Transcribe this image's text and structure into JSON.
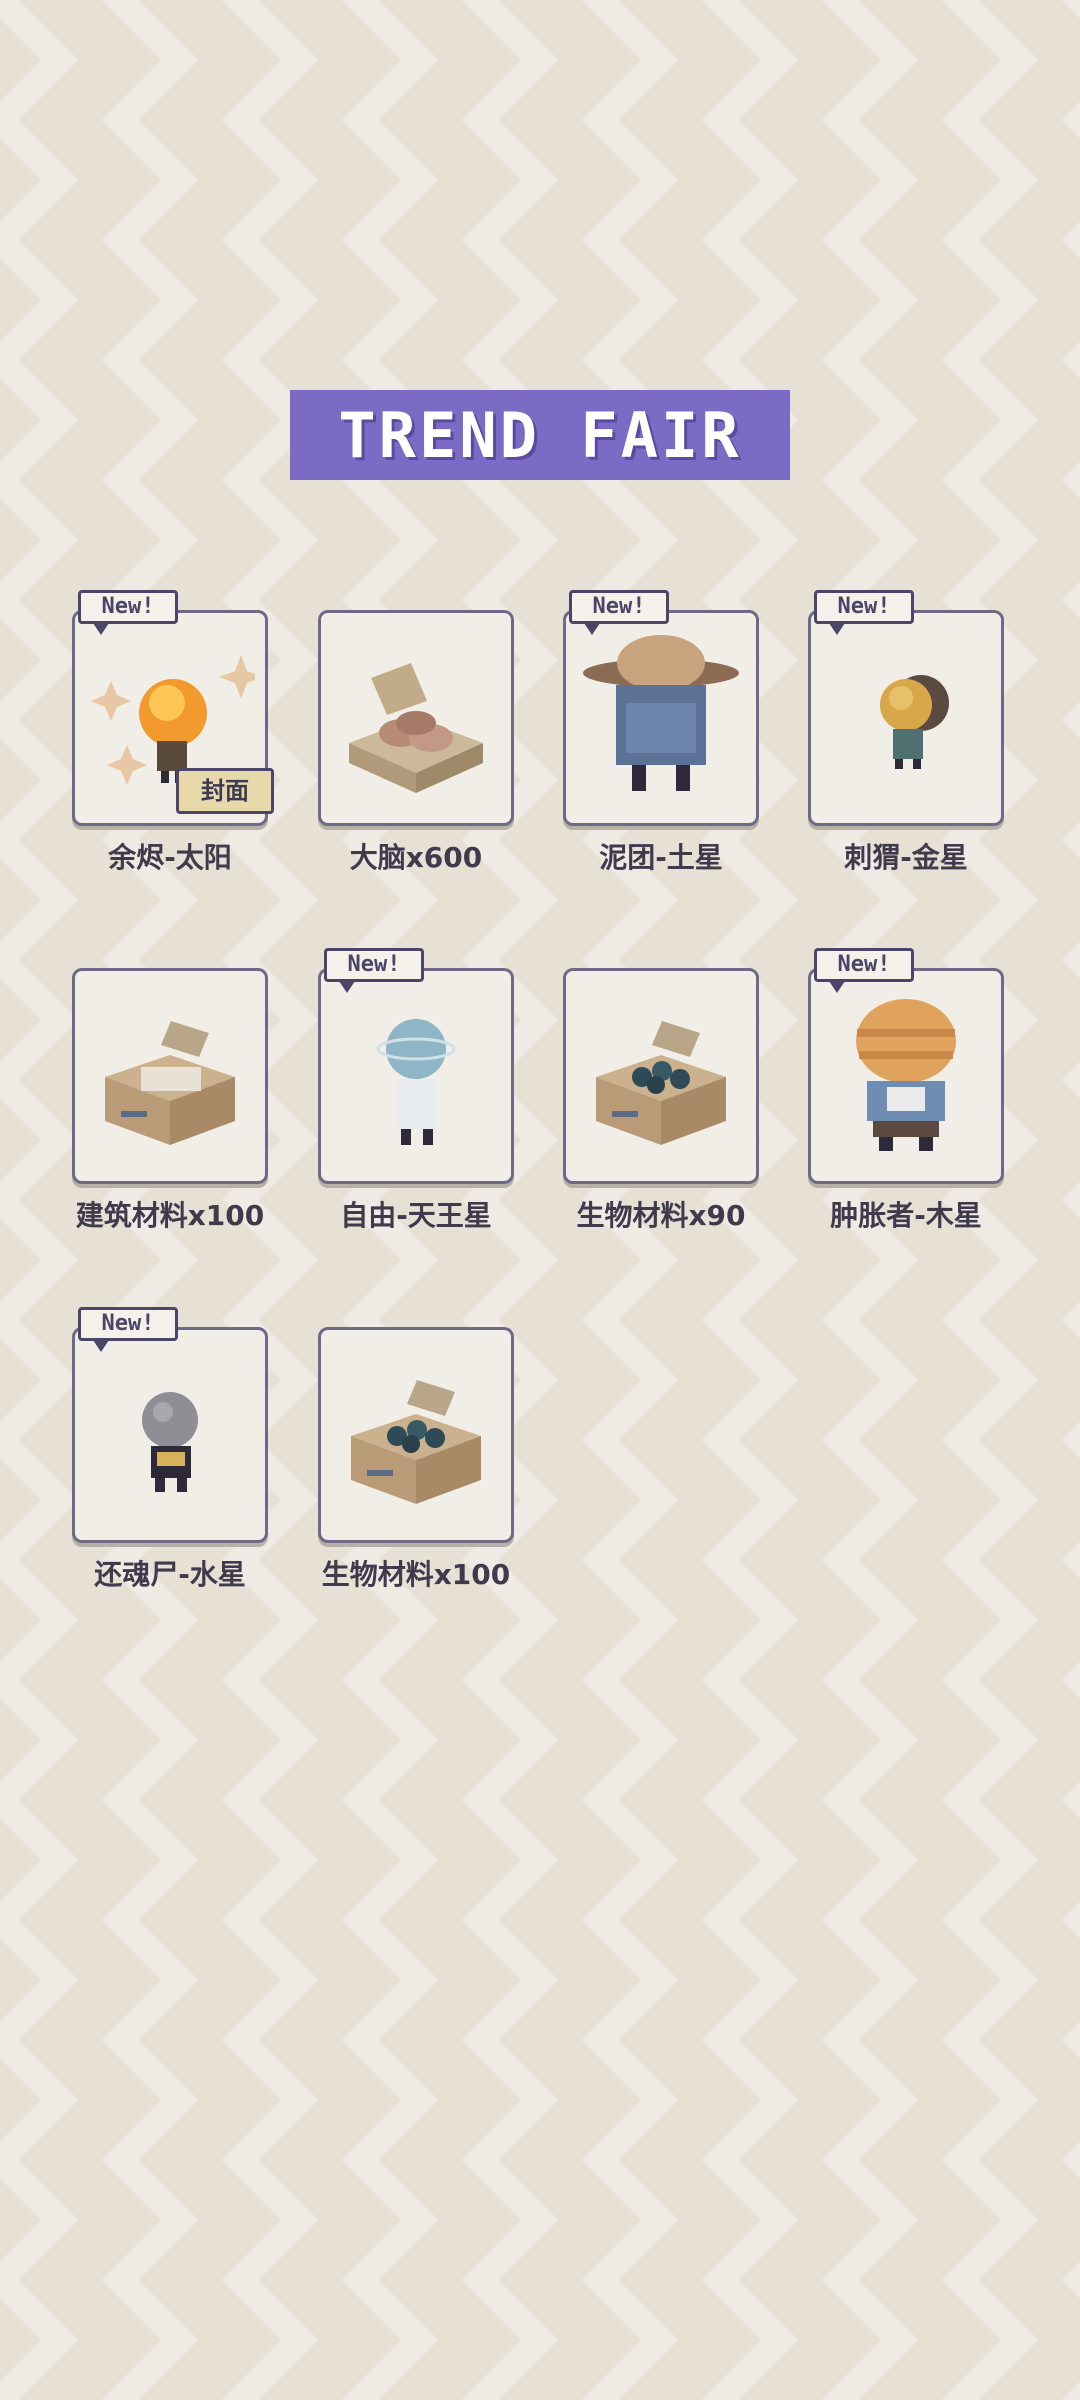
{
  "banner": {
    "title": "TREND FAIR"
  },
  "colors": {
    "background": "#e6e0d5",
    "chevron": "#ece8e0",
    "banner": "#7c6bc4",
    "card_border": "#6e6a86",
    "label_text": "#3f3b4c"
  },
  "items": [
    {
      "label": "余烬-太阳",
      "new": "New!",
      "cover": "封面",
      "icon": "sun-character-icon"
    },
    {
      "label": "大脑x600",
      "new": "",
      "cover": "",
      "icon": "brain-box-icon"
    },
    {
      "label": "泥团-土星",
      "new": "New!",
      "cover": "",
      "icon": "saturn-character-icon"
    },
    {
      "label": "刺猬-金星",
      "new": "New!",
      "cover": "",
      "icon": "venus-character-icon"
    },
    {
      "label": "建筑材料x100",
      "new": "",
      "cover": "",
      "icon": "building-material-crate-icon"
    },
    {
      "label": "自由-天王星",
      "new": "New!",
      "cover": "",
      "icon": "uranus-character-icon"
    },
    {
      "label": "生物材料x90",
      "new": "",
      "cover": "",
      "icon": "bio-material-crate-icon"
    },
    {
      "label": "肿胀者-木星",
      "new": "New!",
      "cover": "",
      "icon": "jupiter-character-icon"
    },
    {
      "label": "还魂尸-水星",
      "new": "New!",
      "cover": "",
      "icon": "mercury-character-icon"
    },
    {
      "label": "生物材料x100",
      "new": "",
      "cover": "",
      "icon": "bio-material-crate-icon"
    }
  ]
}
